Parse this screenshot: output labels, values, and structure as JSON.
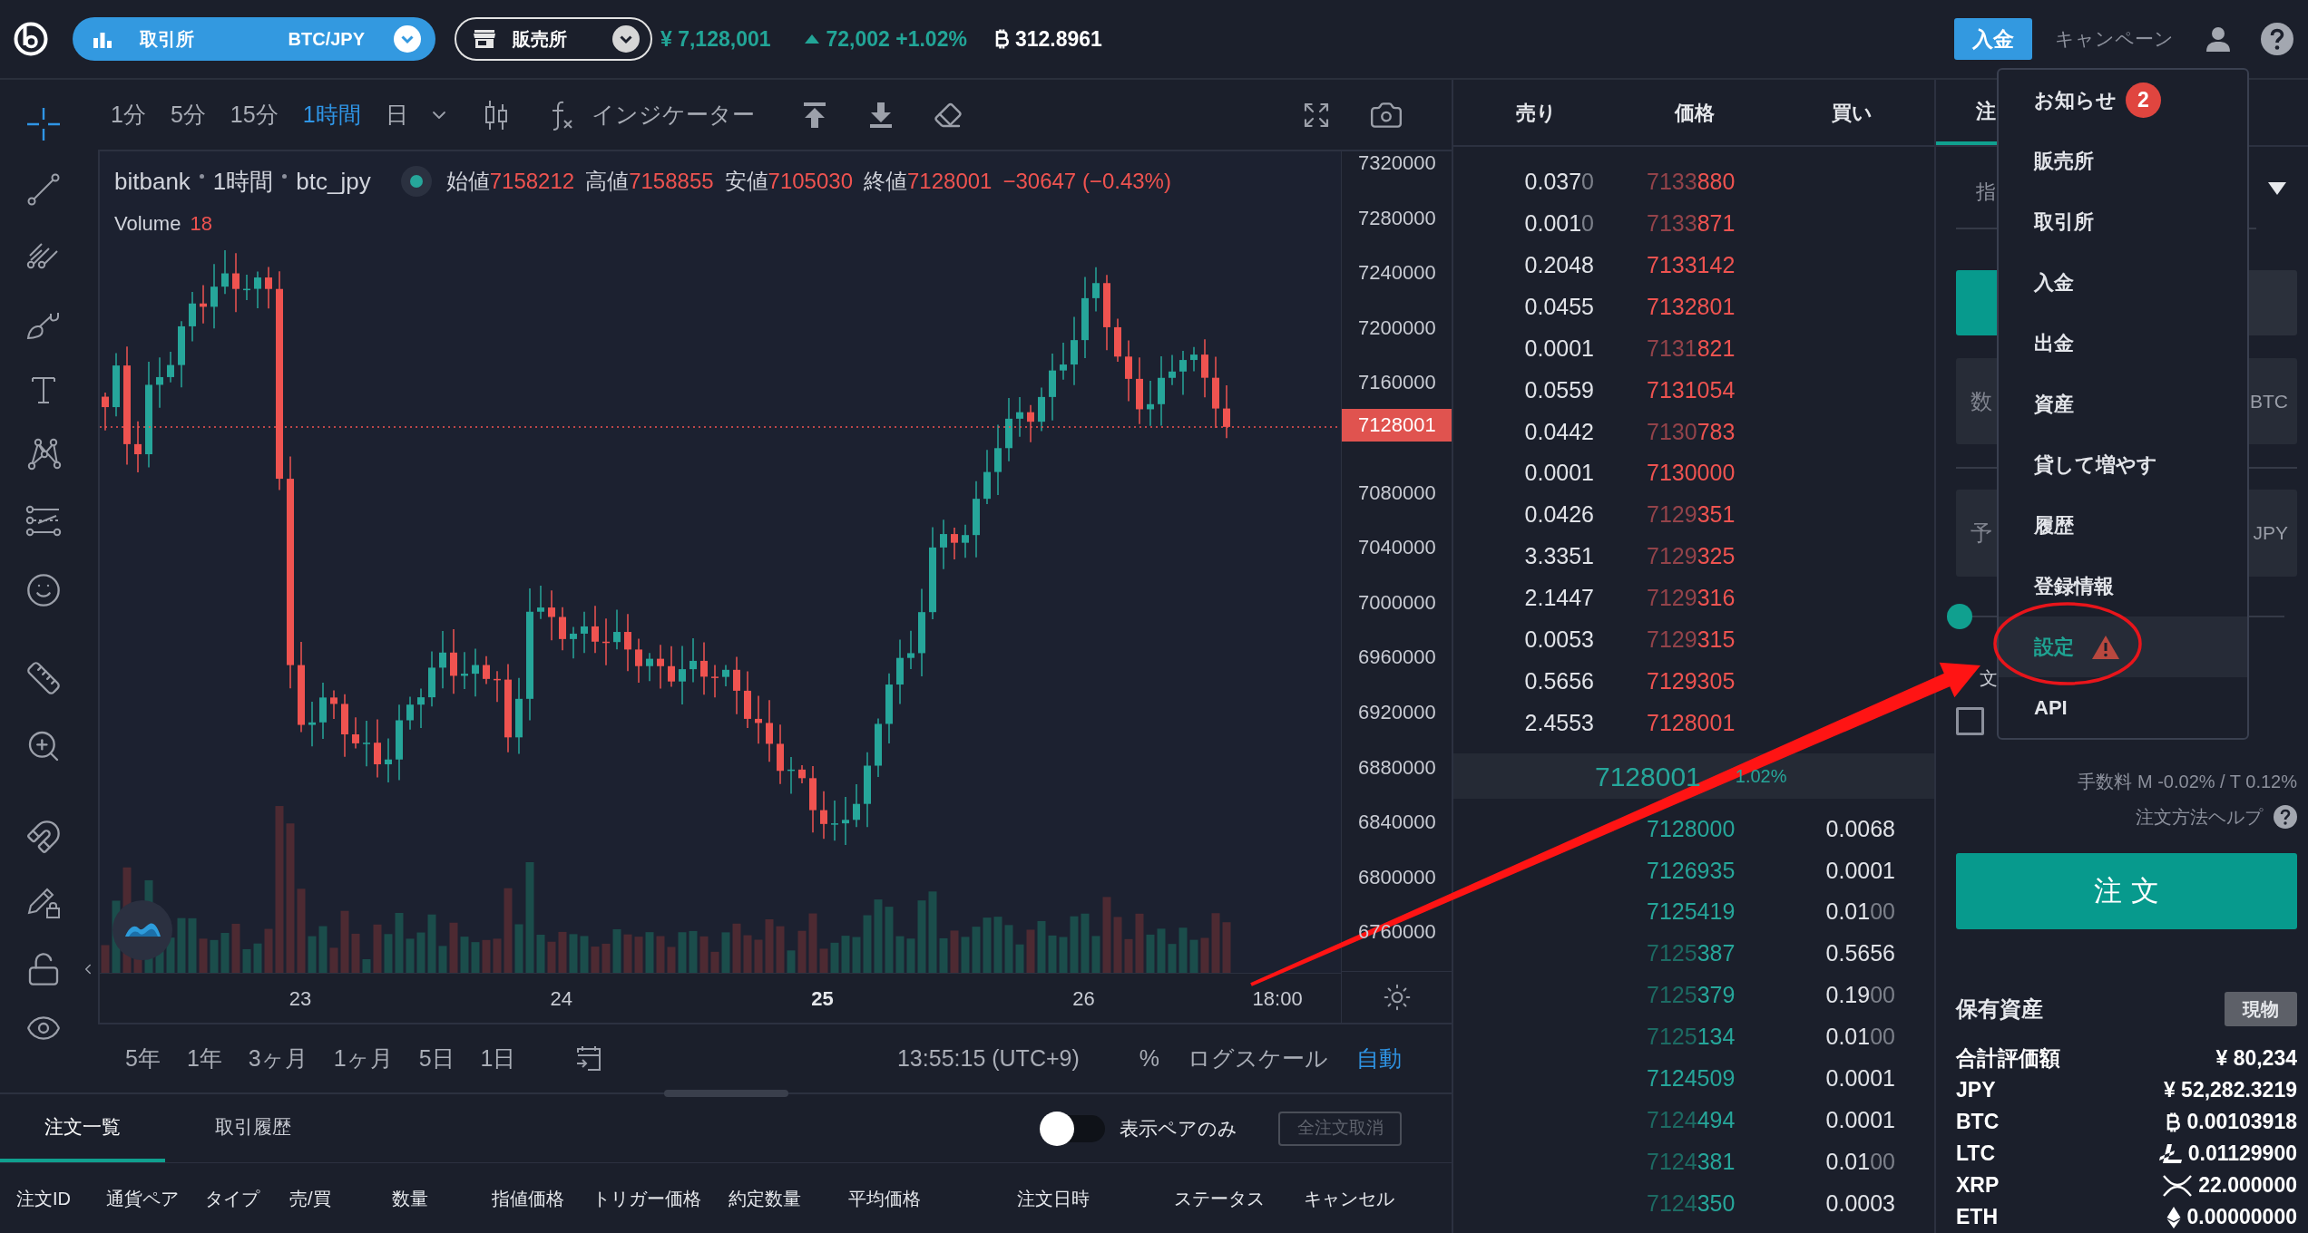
{
  "top_bar": {
    "market_selector": {
      "label": "取引所",
      "pair": "BTC/JPY"
    },
    "store_selector": {
      "label": "販売所"
    },
    "price": "¥ 7,128,001",
    "change": {
      "up": true,
      "text": "72,002 +1.02%"
    },
    "volume": "312.8961",
    "deposit_button": "入金",
    "campaign_link": "キャンペーン"
  },
  "chart": {
    "intervals": [
      {
        "label": "1分",
        "selected": false
      },
      {
        "label": "5分",
        "selected": false
      },
      {
        "label": "15分",
        "selected": false
      },
      {
        "label": "1時間",
        "selected": true
      },
      {
        "label": "日",
        "selected": false
      }
    ],
    "indicator_button": "インジケーター",
    "legend": {
      "source": "bitbank",
      "interval": "1時間",
      "symbol": "btc_jpy",
      "negative": true,
      "values": [
        {
          "label": "始値",
          "value": "7158212"
        },
        {
          "label": "高値",
          "value": "7158855"
        },
        {
          "label": "安値",
          "value": "7105030"
        },
        {
          "label": "終値",
          "value": "7128001"
        }
      ],
      "change": "−30647 (−0.43%)",
      "volume_label": "Volume",
      "volume_value": "18"
    },
    "price_axis": {
      "labels_above": [
        "7320000",
        "7280000",
        "7240000",
        "7200000",
        "7160000"
      ],
      "current_price": "7128001",
      "labels_below": [
        "7080000",
        "7040000",
        "7000000",
        "6960000",
        "6920000",
        "6880000",
        "6840000",
        "6800000",
        "6760000"
      ]
    },
    "time_axis": [
      {
        "text": "23",
        "kind": "day",
        "emphasized": false
      },
      {
        "text": "24",
        "kind": "day",
        "emphasized": false
      },
      {
        "text": "25",
        "kind": "day",
        "emphasized": true
      },
      {
        "text": "26",
        "kind": "day",
        "emphasized": false
      },
      {
        "text": "18:00",
        "kind": "hour",
        "emphasized": false
      }
    ],
    "ranges": [
      "5年",
      "1年",
      "3ヶ月",
      "1ヶ月",
      "5日",
      "1日"
    ],
    "clock": "13:55:15 (UTC+9)",
    "scale_options": [
      {
        "label": "%",
        "active": false
      },
      {
        "label": "ログスケール",
        "active": false
      },
      {
        "label": "自動",
        "active": true
      }
    ]
  },
  "orders_panel": {
    "tabs": [
      {
        "label": "注文一覧",
        "selected": true
      },
      {
        "label": "取引履歴",
        "selected": false
      }
    ],
    "pair_filter": {
      "label": "表示ペアのみ",
      "on": false
    },
    "cancel_all_button": {
      "label": "全注文取消",
      "disabled": true
    },
    "columns": [
      "注文ID",
      "通貨ペア",
      "タイプ",
      "売/買",
      "数量",
      "指値価格",
      "トリガー価格",
      "約定数量",
      "平均価格",
      "注文日時",
      "ステータス",
      "キャンセル"
    ]
  },
  "order_book": {
    "columns": [
      "売り",
      "価格",
      "買い"
    ],
    "asks": [
      {
        "amount": "0.037",
        "amount_muted": "0",
        "price_muted": "7133",
        "price": "880"
      },
      {
        "amount": "0.001",
        "amount_muted": "0",
        "price_muted": "7133",
        "price": "871"
      },
      {
        "amount": "0.2048",
        "price": "7133142"
      },
      {
        "amount": "0.0455",
        "price": "7132801"
      },
      {
        "amount": "0.0001",
        "price_muted": "7131",
        "price": "821"
      },
      {
        "amount": "0.0559",
        "price": "7131054"
      },
      {
        "amount": "0.0442",
        "price_muted": "7130",
        "price": "783"
      },
      {
        "amount": "0.0001",
        "price": "7130000"
      },
      {
        "amount": "0.0426",
        "price_muted": "7129",
        "price": "351"
      },
      {
        "amount": "3.3351",
        "price_muted": "7129",
        "price": "325"
      },
      {
        "amount": "2.1447",
        "price_muted": "7129",
        "price": "316"
      },
      {
        "amount": "0.0053",
        "price_muted": "7129",
        "price": "315"
      },
      {
        "amount": "0.5656",
        "price": "7129305"
      },
      {
        "amount": "2.4553",
        "price": "7128001"
      }
    ],
    "last_price": "7128001",
    "last_change": "1.02%",
    "bids": [
      {
        "price": "7128000",
        "amount": "0.0068"
      },
      {
        "price": "7126935",
        "amount": "0.0001"
      },
      {
        "price": "7125419",
        "amount": "0.01",
        "amount_muted": "00"
      },
      {
        "price_muted": "7125",
        "price": "387",
        "amount": "0.5656"
      },
      {
        "price_muted": "7125",
        "price": "379",
        "amount": "0.19",
        "amount_muted": "00"
      },
      {
        "price_muted": "7125",
        "price": "134",
        "amount": "0.01",
        "amount_muted": "00"
      },
      {
        "price": "7124509",
        "amount": "0.0001"
      },
      {
        "price_muted": "7124",
        "price": "494",
        "amount": "0.0001"
      },
      {
        "price_muted": "7124",
        "price": "381",
        "amount": "0.01",
        "amount_muted": "00"
      },
      {
        "price_muted": "7124",
        "price": "350",
        "amount": "0.0003"
      }
    ]
  },
  "order_form": {
    "tabs": [
      {
        "label": "注",
        "selected": true
      }
    ],
    "order_type": "指",
    "side_buttons": [
      {
        "selected": true
      },
      {
        "selected": false
      }
    ],
    "amount_field": {
      "placeholder": "数",
      "unit": "BTC"
    },
    "total_field": {
      "placeholder": "予",
      "unit": "JPY"
    },
    "ratio_slider": {
      "level": 0
    },
    "option_title": "文",
    "option_checkbox": {
      "checked": false
    },
    "fee": "手数料 M -0.02% / T 0.12%",
    "help_link": "注文方法ヘルプ",
    "submit_button": "注文"
  },
  "holdings": {
    "title": "保有資産",
    "mode_button": "現物",
    "total_label": "合計評価額",
    "total_value": "¥ 80,234",
    "assets": [
      {
        "name": "JPY",
        "kind": "jpy",
        "value": "¥ 52,282.3219"
      },
      {
        "name": "BTC",
        "kind": "btc",
        "value": "0.00103918"
      },
      {
        "name": "LTC",
        "kind": "ltc",
        "value": "0.01129900"
      },
      {
        "name": "XRP",
        "kind": "xrp",
        "value": "22.000000"
      },
      {
        "name": "ETH",
        "kind": "eth",
        "value": "0.00000000"
      }
    ]
  },
  "account_menu": {
    "items": [
      {
        "label": "お知らせ",
        "badge": "2",
        "selected": false
      },
      {
        "label": "販売所",
        "selected": false
      },
      {
        "label": "取引所",
        "selected": false
      },
      {
        "label": "入金",
        "selected": false
      },
      {
        "label": "出金",
        "selected": false
      },
      {
        "label": "資産",
        "selected": false
      },
      {
        "label": "貸して増やす",
        "selected": false
      },
      {
        "label": "履歴",
        "selected": false
      },
      {
        "label": "登録情報",
        "selected": false
      },
      {
        "label": "設定",
        "selected": true,
        "alert": true
      },
      {
        "label": "API",
        "selected": false
      }
    ]
  }
}
